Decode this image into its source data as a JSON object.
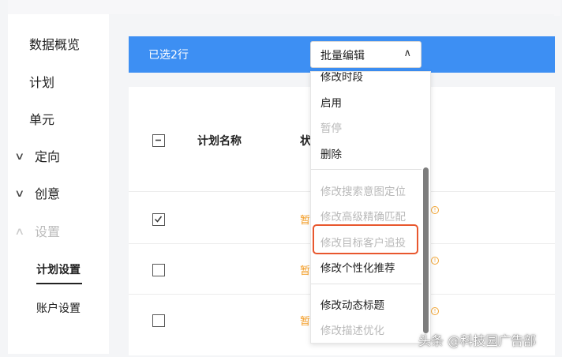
{
  "sidebar": {
    "items": [
      {
        "label": "数据概览"
      },
      {
        "label": "计划"
      },
      {
        "label": "单元"
      },
      {
        "label": "定向"
      },
      {
        "label": "创意"
      },
      {
        "label": "设置"
      }
    ],
    "sub_items": [
      {
        "label": "计划设置"
      },
      {
        "label": "账户设置"
      }
    ]
  },
  "toolbar": {
    "selected_text": "已选2行",
    "bulk_edit_label": "批量编辑"
  },
  "table": {
    "columns": [
      "计划名称",
      "状"
    ],
    "status_label": "暂"
  },
  "dropdown": {
    "items": [
      {
        "label": "修改时段"
      },
      {
        "label": "启用"
      },
      {
        "label": "暂停"
      },
      {
        "label": "删除"
      },
      {
        "label": "修改搜索意图定位"
      },
      {
        "label": "修改高级精确匹配"
      },
      {
        "label": "修改目标客户追投"
      },
      {
        "label": "修改个性化推荐"
      },
      {
        "label": "修改动态标题"
      },
      {
        "label": "修改描述优化"
      }
    ]
  },
  "watermark": "头条 @科技园广告部",
  "colors": {
    "toolbar_blue": "#3d8ff3",
    "status_orange": "#f39a1f",
    "highlight_red": "#e8572e"
  }
}
